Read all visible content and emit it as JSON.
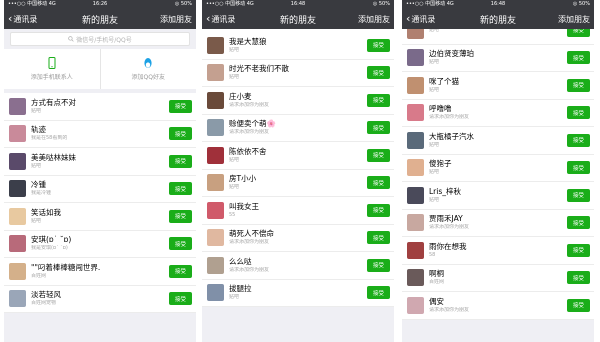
{
  "colors": {
    "nav_bg": "#393a3f",
    "accept_green": "#1aad19",
    "page_bg": "#efeff4"
  },
  "panels": [
    {
      "status": {
        "left": "•••○○ 中国移动 4G",
        "time": "16:26",
        "right": "◎ 50%"
      },
      "nav": {
        "back": "通讯录",
        "title": "新的朋友",
        "action": "添加朋友"
      },
      "search": {
        "placeholder": "微信号/手机号/QQ号",
        "icon": "search-icon"
      },
      "quick": [
        {
          "label": "添加手机联系人",
          "icon": "phone-icon"
        },
        {
          "label": "添加QQ好友",
          "icon": "qq-penguin-icon"
        }
      ],
      "accept_label": "接受",
      "rows": [
        {
          "name": "方式有点不对",
          "sub": "贴吧",
          "avatar": "#8a6f8f"
        },
        {
          "name": "轨迹",
          "sub": "我是在58看到的",
          "avatar": "#c98a9a"
        },
        {
          "name": "美美哒林妹妹",
          "sub": "贴吧",
          "avatar": "#5a4a6a"
        },
        {
          "name": "冷锺",
          "sub": "我是冷锺",
          "avatar": "#3b3e4a"
        },
        {
          "name": "笑话如我",
          "sub": "贴吧",
          "avatar": "#e8c9a0"
        },
        {
          "name": "安琪(ɒ˙ ˘ɒ)",
          "sub": "我是安琪(ɒ˙ ˘ɒ)",
          "avatar": "#b86a7a"
        },
        {
          "name": "\"\"叼着棒棒糖闯世界.",
          "sub": "百姓网",
          "avatar": "#d4b08a"
        },
        {
          "name": "淡若轻风",
          "sub": "百姓网宠物",
          "avatar": "#9aa6b8"
        }
      ]
    },
    {
      "status": {
        "left": "•••○○ 中国移动 4G",
        "time": "16:48",
        "right": "◎ 50%"
      },
      "nav": {
        "back": "通讯录",
        "title": "新的朋友",
        "action": "添加朋友"
      },
      "accept_label": "接受",
      "rows": [
        {
          "name": "我是大慧狼",
          "sub": "贴吧",
          "avatar": "#7a5a4a"
        },
        {
          "name": "时光不老我们不散",
          "sub": "贴吧",
          "avatar": "#c4a090"
        },
        {
          "name": "庄小麦",
          "sub": "请求添加你为朋友",
          "avatar": "#6a4a3a"
        },
        {
          "name": "赊便卖个萌🌸",
          "sub": "请求添加你为朋友",
          "avatar": "#8a9aa8"
        },
        {
          "name": "陈依依不舍",
          "sub": "贴吧",
          "avatar": "#a0303a"
        },
        {
          "name": "房T小小",
          "sub": "贴吧",
          "avatar": "#c8a080"
        },
        {
          "name": "叫我女王",
          "sub": "55",
          "avatar": "#d05a6a"
        },
        {
          "name": "萌死人不偿命",
          "sub": "请求添加你为朋友",
          "avatar": "#e0b8a0"
        },
        {
          "name": "么么哒",
          "sub": "请求添加你为朋友",
          "avatar": "#b0a090"
        },
        {
          "name": "拔腿拉",
          "sub": "贴吧",
          "avatar": "#8090a8"
        }
      ]
    },
    {
      "status": {
        "left": "•••○○ 中国移动 4G",
        "time": "16:48",
        "right": "◎ 50%"
      },
      "nav": {
        "back": "通讯录",
        "title": "新的朋友",
        "action": "添加朋友"
      },
      "accept_label": "接受",
      "rows": [
        {
          "name": "",
          "sub": "贴吧",
          "avatar": "#b08070"
        },
        {
          "name": "边伯贤变薄珀",
          "sub": "贴吧",
          "avatar": "#7a6a8a"
        },
        {
          "name": "咪了个猫",
          "sub": "贴吧",
          "avatar": "#c09070"
        },
        {
          "name": "呼噜噜",
          "sub": "请求添加你为朋友",
          "avatar": "#d87a8a"
        },
        {
          "name": "大瓶橘子汽水",
          "sub": "贴吧",
          "avatar": "#5a6a7a"
        },
        {
          "name": "傻狍子",
          "sub": "贴吧",
          "avatar": "#e0b090"
        },
        {
          "name": "Lris_梓秋",
          "sub": "贴吧",
          "avatar": "#4a4a5a"
        },
        {
          "name": "贾雨禾JAY",
          "sub": "请求添加你为朋友",
          "avatar": "#c8a8a0"
        },
        {
          "name": "雨你在想我",
          "sub": "58",
          "avatar": "#a04040"
        },
        {
          "name": "啊桐",
          "sub": "百姓网",
          "avatar": "#6a5a5a"
        },
        {
          "name": "偶安",
          "sub": "请求添加你为朋友",
          "avatar": "#d0a8b0"
        }
      ]
    }
  ]
}
